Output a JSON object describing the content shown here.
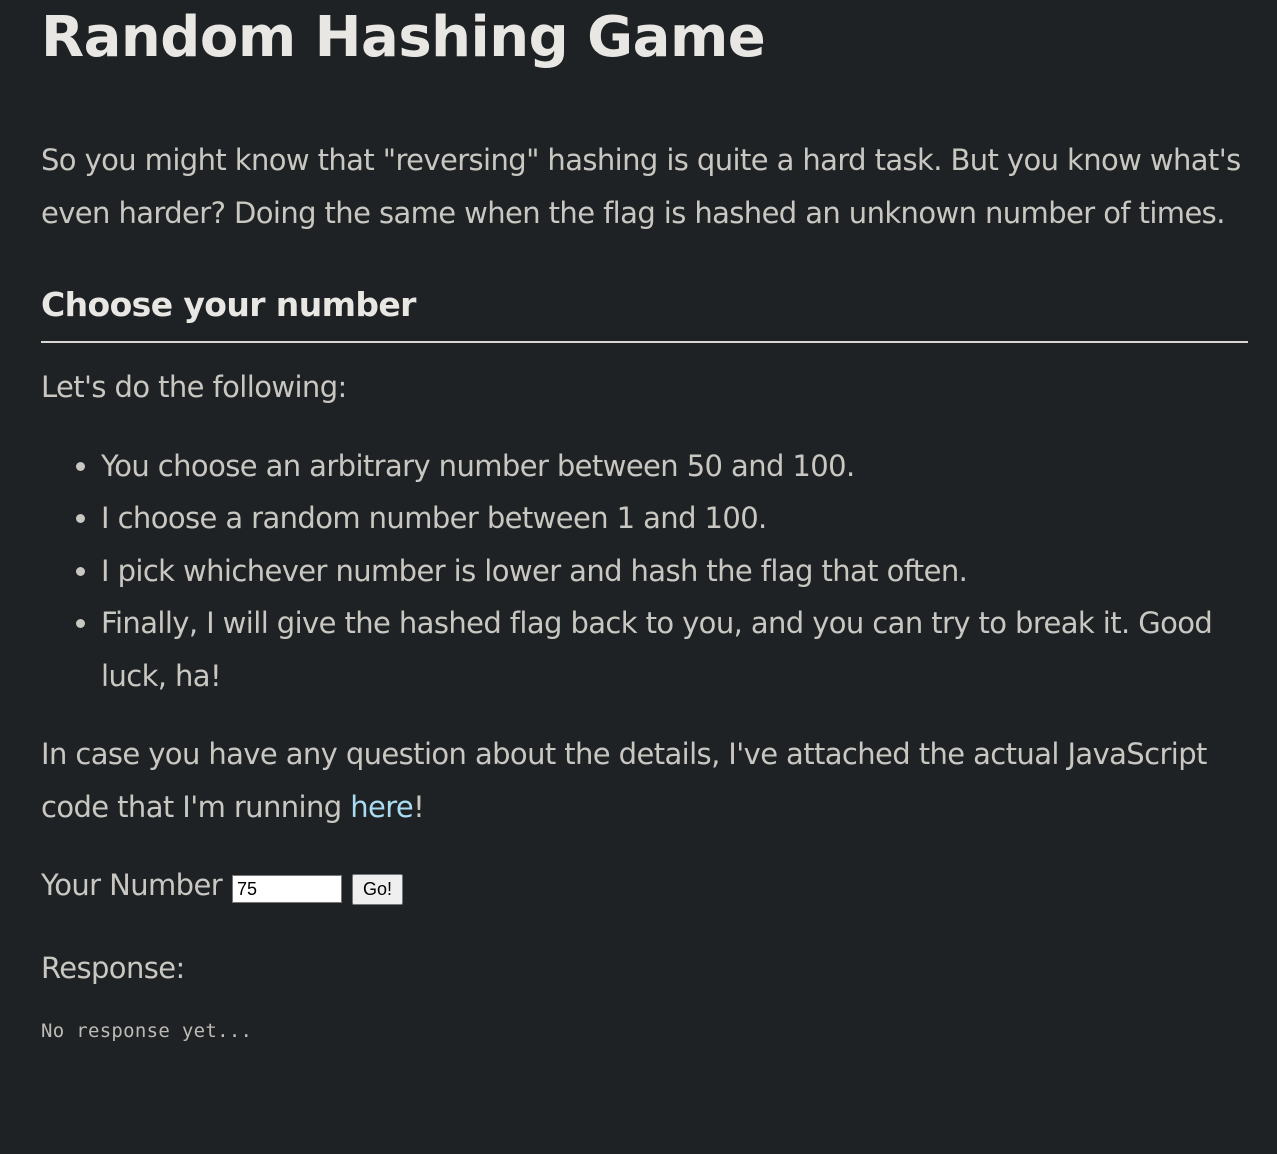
{
  "page": {
    "title": "Random Hashing Game",
    "intro": "So you might know that \"reversing\" hashing is quite a hard task. But you know what's even harder? Doing the same when the flag is hashed an unknown number of times."
  },
  "section": {
    "heading": "Choose your number",
    "lead": "Let's do the following:",
    "steps": [
      "You choose an arbitrary number between 50 and 100.",
      "I choose a random number between 1 and 100.",
      "I pick whichever number is lower and hash the flag that often.",
      "Finally, I will give the hashed flag back to you, and you can try to break it. Good luck, ha!"
    ],
    "note_prefix": "In case you have any question about the details, I've attached the actual JavaScript code that I'm running ",
    "note_link": "here",
    "note_suffix": "!"
  },
  "form": {
    "label": "Your Number",
    "value": "75",
    "button": "Go!"
  },
  "response": {
    "label": "Response:",
    "text": "No response yet..."
  }
}
